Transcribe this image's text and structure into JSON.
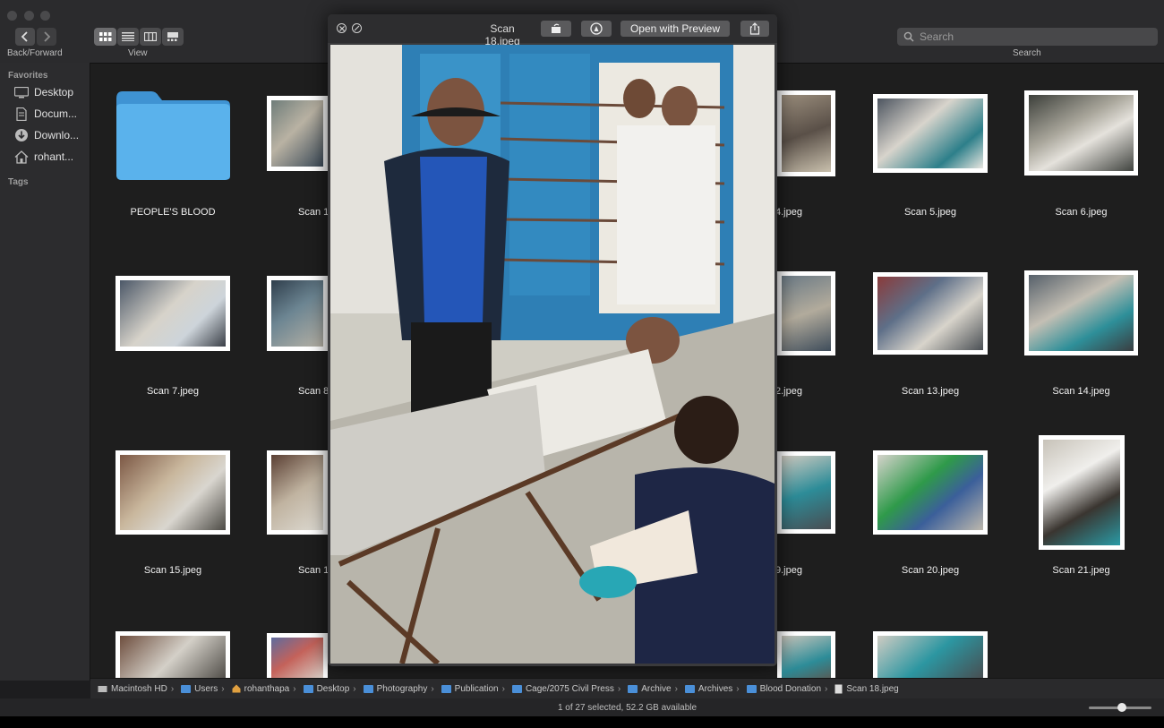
{
  "toolbar": {
    "nav_label": "Back/Forward",
    "view_label": "View",
    "search_placeholder": "Search",
    "search_label": "Search"
  },
  "sidebar": {
    "favorites_header": "Favorites",
    "items": [
      {
        "label": "Desktop",
        "icon": "desktop-icon"
      },
      {
        "label": "Docum...",
        "icon": "documents-icon"
      },
      {
        "label": "Downlo...",
        "icon": "downloads-icon"
      },
      {
        "label": "rohant...",
        "icon": "home-icon"
      }
    ],
    "tags_header": "Tags"
  },
  "files": [
    {
      "name": "PEOPLE'S BLOOD",
      "kind": "folder"
    },
    {
      "name": "Scan 1",
      "kind": "image"
    },
    {
      "name": "4.jpeg",
      "kind": "image"
    },
    {
      "name": "Scan 5.jpeg",
      "kind": "image"
    },
    {
      "name": "Scan 6.jpeg",
      "kind": "image"
    },
    {
      "name": "Scan 7.jpeg",
      "kind": "image"
    },
    {
      "name": "Scan 8",
      "kind": "image"
    },
    {
      "name": "2.jpeg",
      "kind": "image"
    },
    {
      "name": "Scan 13.jpeg",
      "kind": "image"
    },
    {
      "name": "Scan 14.jpeg",
      "kind": "image"
    },
    {
      "name": "Scan 15.jpeg",
      "kind": "image"
    },
    {
      "name": "Scan 1",
      "kind": "image"
    },
    {
      "name": "9.jpeg",
      "kind": "image"
    },
    {
      "name": "Scan 20.jpeg",
      "kind": "image"
    },
    {
      "name": "Scan 21.jpeg",
      "kind": "image"
    }
  ],
  "quicklook": {
    "title": "Scan 18.jpeg",
    "open_button": "Open with Preview"
  },
  "pathbar": [
    "Macintosh HD",
    "Users",
    "rohanthapa",
    "Desktop",
    "Photography",
    "Publication",
    "Cage/2075 Civil Press",
    "Archive",
    "Archives",
    "Blood Donation",
    "Scan 18.jpeg"
  ],
  "status": {
    "text": "1 of 27 selected, 52.2 GB available",
    "zoom_level": 0.45
  },
  "colors": {
    "folder": "#4aa3e0",
    "window_bg": "#1e1e1e",
    "accent": "#4a8fd8"
  }
}
